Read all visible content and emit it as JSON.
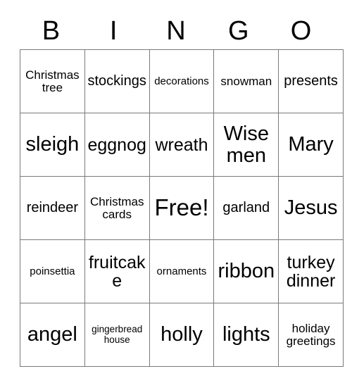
{
  "card": {
    "title": "BINGO",
    "header_letters": [
      "B",
      "I",
      "N",
      "G",
      "O"
    ],
    "rows": [
      [
        {
          "text": "Christmas tree",
          "size": "md"
        },
        {
          "text": "stockings",
          "size": "lg"
        },
        {
          "text": "decorations",
          "size": "sm"
        },
        {
          "text": "snowman",
          "size": "md"
        },
        {
          "text": "presents",
          "size": "lg"
        }
      ],
      [
        {
          "text": "sleigh",
          "size": "xxl"
        },
        {
          "text": "eggnog",
          "size": "xl"
        },
        {
          "text": "wreath",
          "size": "xl"
        },
        {
          "text": "Wise men",
          "size": "xxl"
        },
        {
          "text": "Mary",
          "size": "xxl"
        }
      ],
      [
        {
          "text": "reindeer",
          "size": "lg"
        },
        {
          "text": "Christmas cards",
          "size": "md"
        },
        {
          "text": "Free!",
          "size": "free"
        },
        {
          "text": "garland",
          "size": "lg"
        },
        {
          "text": "Jesus",
          "size": "xxl"
        }
      ],
      [
        {
          "text": "poinsettia",
          "size": "sm"
        },
        {
          "text": "fruitcake",
          "size": "xl"
        },
        {
          "text": "ornaments",
          "size": "sm"
        },
        {
          "text": "ribbon",
          "size": "xxl"
        },
        {
          "text": "turkey dinner",
          "size": "xl"
        }
      ],
      [
        {
          "text": "angel",
          "size": "xxl"
        },
        {
          "text": "gingerbread house",
          "size": "xs"
        },
        {
          "text": "holly",
          "size": "xxl"
        },
        {
          "text": "lights",
          "size": "xxl"
        },
        {
          "text": "holiday greetings",
          "size": "md"
        }
      ]
    ]
  },
  "colors": {
    "background": "#ffffff",
    "text": "#000000",
    "grid_line": "#7a7a7a"
  }
}
